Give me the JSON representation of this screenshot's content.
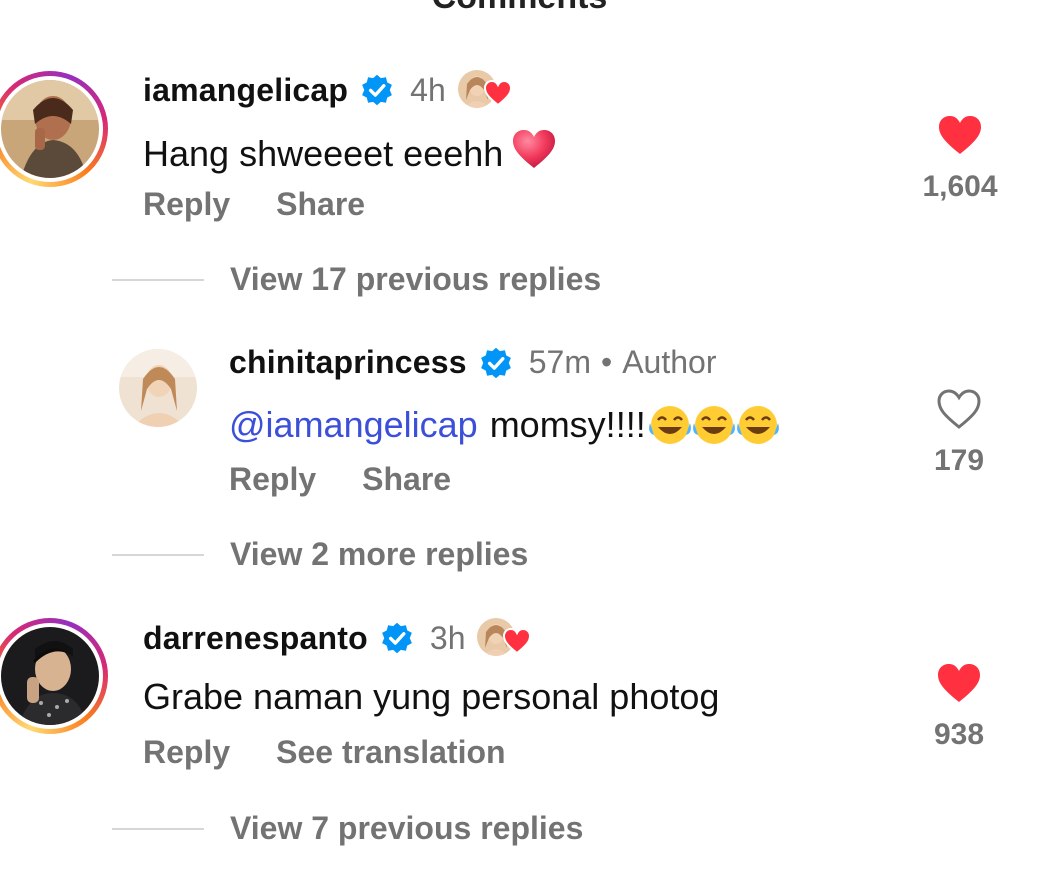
{
  "section_title": "Comments",
  "colors": {
    "like_red": "#ff3040",
    "verified_blue": "#0095f6",
    "mention_blue": "#3b4fd9",
    "muted_text": "#737373"
  },
  "comments": [
    {
      "username": "iamangelicap",
      "verified": true,
      "time": "4h",
      "text": "Hang shweeeet eeehh",
      "text_emoji": "❤️",
      "creator_liked": true,
      "actions": [
        "Reply",
        "Share"
      ],
      "liked": true,
      "like_count": "1,604",
      "view_replies": "View 17 previous replies"
    },
    {
      "username": "chinitaprincess",
      "verified": true,
      "time": "57m",
      "separator": "•",
      "badge": "Author",
      "mention": "@iamangelicap",
      "text": "momsy!!!!",
      "text_emoji": "😂😂😂",
      "actions": [
        "Reply",
        "Share"
      ],
      "liked": false,
      "like_count": "179",
      "view_replies": "View 2 more replies"
    },
    {
      "username": "darrenespanto",
      "verified": true,
      "time": "3h",
      "text": "Grabe naman yung personal photog",
      "creator_liked": true,
      "actions": [
        "Reply",
        "See translation"
      ],
      "liked": true,
      "like_count": "938",
      "view_replies": "View 7 previous replies"
    }
  ]
}
